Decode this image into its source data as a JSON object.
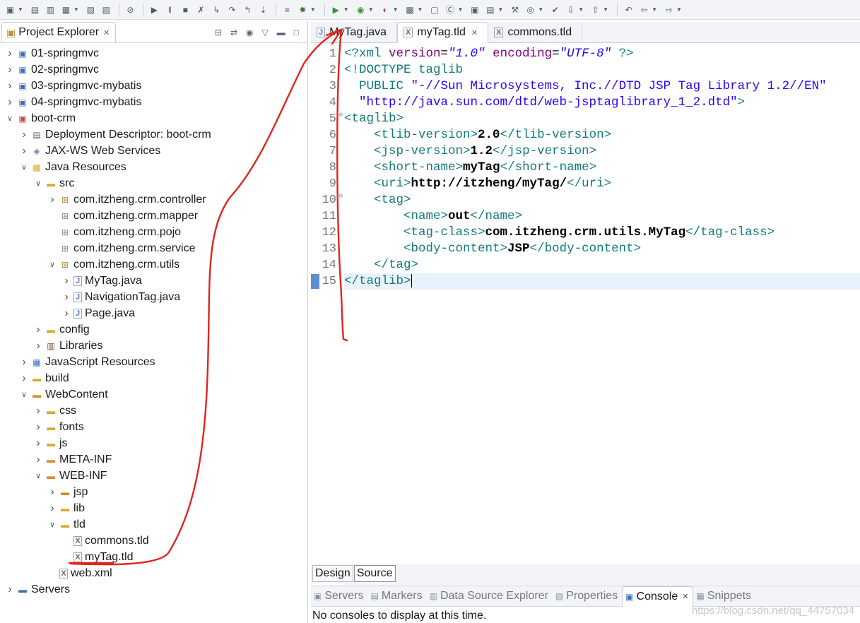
{
  "toolbar": {
    "icons": [
      "new-icon",
      "save-icon",
      "save-all-icon",
      "print-icon",
      "properties-icon",
      "terminal-icon",
      "skip-breakpoints-icon",
      "resume-icon",
      "suspend-icon",
      "stop-icon",
      "disconnect-icon",
      "step-into-icon",
      "step-over-icon",
      "step-return-icon",
      "drop-frame-icon",
      "build-icon",
      "debug-icon",
      "run-icon",
      "run-server-icon",
      "coverage-icon",
      "new-server-icon",
      "new-package-icon",
      "new-class-icon",
      "open-type-icon",
      "open-task-icon",
      "search-icon",
      "web-browser-icon",
      "toggle-mark-icon",
      "next-annotation-icon",
      "prev-annotation-icon",
      "last-edit-icon",
      "back-icon",
      "forward-icon"
    ]
  },
  "explorer": {
    "title": "Project Explorer",
    "tree": [
      {
        "label": "01-springmvc",
        "depth": 0,
        "state": "collapsed",
        "icon": "project-icon"
      },
      {
        "label": "02-springmvc",
        "depth": 0,
        "state": "collapsed",
        "icon": "project-icon"
      },
      {
        "label": "03-springmvc-mybatis",
        "depth": 0,
        "state": "collapsed",
        "icon": "project-icon"
      },
      {
        "label": "04-springmvc-mybatis",
        "depth": 0,
        "state": "collapsed",
        "icon": "project-icon"
      },
      {
        "label": "boot-crm",
        "depth": 0,
        "state": "expanded",
        "icon": "web-project-icon"
      },
      {
        "label": "Deployment Descriptor: boot-crm",
        "depth": 1,
        "state": "collapsed",
        "icon": "deployment-descriptor-icon"
      },
      {
        "label": "JAX-WS Web Services",
        "depth": 1,
        "state": "collapsed",
        "icon": "web-services-icon"
      },
      {
        "label": "Java Resources",
        "depth": 1,
        "state": "expanded",
        "icon": "java-resources-icon"
      },
      {
        "label": "src",
        "depth": 2,
        "state": "expanded",
        "icon": "source-folder-icon"
      },
      {
        "label": "com.itzheng.crm.controller",
        "depth": 3,
        "state": "collapsed",
        "icon": "package-icon"
      },
      {
        "label": "com.itzheng.crm.mapper",
        "depth": 3,
        "state": "none",
        "icon": "empty-package-icon"
      },
      {
        "label": "com.itzheng.crm.pojo",
        "depth": 3,
        "state": "none",
        "icon": "empty-package-icon"
      },
      {
        "label": "com.itzheng.crm.service",
        "depth": 3,
        "state": "none",
        "icon": "empty-package-icon"
      },
      {
        "label": "com.itzheng.crm.utils",
        "depth": 3,
        "state": "expanded",
        "icon": "package-icon"
      },
      {
        "label": "MyTag.java",
        "depth": 4,
        "state": "collapsed",
        "icon": "java-file-icon"
      },
      {
        "label": "NavigationTag.java",
        "depth": 4,
        "state": "collapsed",
        "icon": "java-file-icon"
      },
      {
        "label": "Page.java",
        "depth": 4,
        "state": "collapsed",
        "icon": "java-file-icon"
      },
      {
        "label": "config",
        "depth": 2,
        "state": "collapsed",
        "icon": "source-folder-icon"
      },
      {
        "label": "Libraries",
        "depth": 2,
        "state": "collapsed",
        "icon": "libraries-icon"
      },
      {
        "label": "JavaScript Resources",
        "depth": 1,
        "state": "collapsed",
        "icon": "javascript-resources-icon"
      },
      {
        "label": "build",
        "depth": 1,
        "state": "collapsed",
        "icon": "folder-icon"
      },
      {
        "label": "WebContent",
        "depth": 1,
        "state": "expanded",
        "icon": "web-folder-icon"
      },
      {
        "label": "css",
        "depth": 2,
        "state": "collapsed",
        "icon": "folder-icon"
      },
      {
        "label": "fonts",
        "depth": 2,
        "state": "collapsed",
        "icon": "folder-icon"
      },
      {
        "label": "js",
        "depth": 2,
        "state": "collapsed",
        "icon": "folder-icon"
      },
      {
        "label": "META-INF",
        "depth": 2,
        "state": "collapsed",
        "icon": "web-folder-icon"
      },
      {
        "label": "WEB-INF",
        "depth": 2,
        "state": "expanded",
        "icon": "web-folder-icon"
      },
      {
        "label": "jsp",
        "depth": 3,
        "state": "collapsed",
        "icon": "web-folder-icon"
      },
      {
        "label": "lib",
        "depth": 3,
        "state": "collapsed",
        "icon": "folder-icon"
      },
      {
        "label": "tld",
        "depth": 3,
        "state": "expanded",
        "icon": "folder-icon"
      },
      {
        "label": "commons.tld",
        "depth": 4,
        "state": "none",
        "icon": "xml-file-icon"
      },
      {
        "label": "myTag.tld",
        "depth": 4,
        "state": "none",
        "icon": "xml-file-icon"
      },
      {
        "label": "web.xml",
        "depth": 3,
        "state": "none",
        "icon": "xml-file-icon"
      },
      {
        "label": "Servers",
        "depth": 0,
        "state": "collapsed",
        "icon": "servers-folder-icon"
      }
    ]
  },
  "editor": {
    "tabs": [
      {
        "label": "MyTag.java",
        "icon": "java-file-icon",
        "active": false
      },
      {
        "label": "myTag.tld",
        "icon": "xml-file-icon",
        "active": true
      },
      {
        "label": "commons.tld",
        "icon": "xml-file-icon",
        "active": false
      }
    ],
    "folds": [
      5,
      10
    ],
    "current_line": 15,
    "lines": [
      [
        [
          "t-tag",
          "<?xml "
        ],
        [
          "t-attr",
          "version"
        ],
        [
          "",
          "="
        ],
        [
          "t-str",
          "\"1.0\""
        ],
        [
          "",
          " "
        ],
        [
          "t-attr",
          "encoding"
        ],
        [
          "",
          "="
        ],
        [
          "t-str",
          "\"UTF-8\""
        ],
        [
          "",
          " "
        ],
        [
          "t-tag",
          "?>"
        ]
      ],
      [
        [
          "t-doc",
          "<!DOCTYPE taglib"
        ]
      ],
      [
        [
          "t-doc",
          "  PUBLIC "
        ],
        [
          "t-str-n",
          "\"-//Sun Microsystems, Inc.//DTD JSP Tag Library 1.2//EN\""
        ]
      ],
      [
        [
          "t-str-n",
          "  \"http://java.sun.com/dtd/web-jsptaglibrary_1_2.dtd\""
        ],
        [
          "t-doc",
          ">"
        ]
      ],
      [
        [
          "t-tag",
          "<taglib>"
        ]
      ],
      [
        [
          "",
          "    "
        ],
        [
          "t-tag",
          "<tlib-version>"
        ],
        [
          "t-text",
          "2.0"
        ],
        [
          "t-tag",
          "</tlib-version>"
        ]
      ],
      [
        [
          "",
          "    "
        ],
        [
          "t-tag",
          "<jsp-version>"
        ],
        [
          "t-text",
          "1.2"
        ],
        [
          "t-tag",
          "</jsp-version>"
        ]
      ],
      [
        [
          "",
          "    "
        ],
        [
          "t-tag",
          "<short-name>"
        ],
        [
          "t-text",
          "myTag"
        ],
        [
          "t-tag",
          "</short-name>"
        ]
      ],
      [
        [
          "",
          "    "
        ],
        [
          "t-tag",
          "<uri>"
        ],
        [
          "t-text",
          "http://itzheng/myTag/"
        ],
        [
          "t-tag",
          "</uri>"
        ]
      ],
      [
        [
          "",
          "    "
        ],
        [
          "t-tag",
          "<tag>"
        ]
      ],
      [
        [
          "",
          "        "
        ],
        [
          "t-tag",
          "<name>"
        ],
        [
          "t-text",
          "out"
        ],
        [
          "t-tag",
          "</name>"
        ]
      ],
      [
        [
          "",
          "        "
        ],
        [
          "t-tag",
          "<tag-class>"
        ],
        [
          "t-text",
          "com.itzheng.crm.utils.MyTag"
        ],
        [
          "t-tag",
          "</tag-class>"
        ]
      ],
      [
        [
          "",
          "        "
        ],
        [
          "t-tag",
          "<body-content>"
        ],
        [
          "t-text",
          "JSP"
        ],
        [
          "t-tag",
          "</body-content>"
        ]
      ],
      [
        [
          "",
          "    "
        ],
        [
          "t-tag",
          "</tag>"
        ]
      ],
      [
        [
          "t-tag",
          "</taglib>"
        ]
      ]
    ],
    "modes": [
      {
        "label": "Design",
        "active": false
      },
      {
        "label": "Source",
        "active": true
      }
    ]
  },
  "console": {
    "tabs": [
      {
        "label": "Servers",
        "icon": "servers-icon",
        "active": false
      },
      {
        "label": "Markers",
        "icon": "markers-icon",
        "active": false
      },
      {
        "label": "Data Source Explorer",
        "icon": "data-source-icon",
        "active": false
      },
      {
        "label": "Properties",
        "icon": "properties-icon",
        "active": false
      },
      {
        "label": "Console",
        "icon": "console-icon",
        "active": true
      },
      {
        "label": "Snippets",
        "icon": "snippets-icon",
        "active": false
      }
    ],
    "message": "No consoles to display at this time.",
    "watermark": "https://blog.csdn.net/qq_44757034"
  },
  "colors": {
    "annotation": "#e0251e",
    "tag": "#117a7a",
    "attribute": "#7f007f",
    "string": "#2a00ff",
    "current_line": "#e8f2fe"
  }
}
